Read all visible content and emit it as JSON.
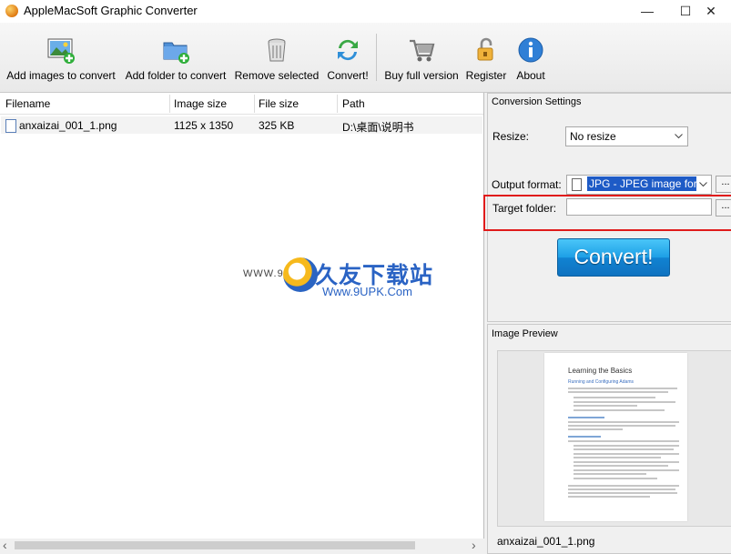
{
  "window": {
    "title": "AppleMacSoft Graphic Converter",
    "minimize": "—",
    "maximize": "☐",
    "close": "✕"
  },
  "toolbar": {
    "add_images": "Add images to convert",
    "add_folder": "Add folder to convert",
    "remove_selected": "Remove selected",
    "convert": "Convert!",
    "buy_full": "Buy full version",
    "register": "Register",
    "about": "About"
  },
  "file_list": {
    "columns": [
      "Filename",
      "Image size",
      "File size",
      "Path"
    ],
    "rows": [
      {
        "filename": "anxaizai_001_1.png",
        "image_size": "1125 x 1350",
        "file_size": "325 KB",
        "path": "D:\\桌面\\说明书"
      }
    ]
  },
  "settings": {
    "section_title": "Conversion Settings",
    "resize_label": "Resize:",
    "resize_value": "No resize",
    "output_format_label": "Output format:",
    "output_format_value": "JPG - JPEG image forma",
    "target_folder_label": "Target folder:",
    "target_folder_value": "",
    "browse": "...",
    "convert_button": "Convert!"
  },
  "preview": {
    "section_title": "Image Preview",
    "doc_title": "Learning the Basics",
    "doc_subtitle": "Running and Configuring Adams",
    "filename": "anxaizai_001_1.png"
  },
  "watermark": {
    "left": "WWW.9U",
    "text": "久友下载站",
    "url": "Www.9UPK.Com"
  },
  "scroll": {
    "left": "‹",
    "right": "›"
  },
  "colors": {
    "accent": "#1d9fe6",
    "highlight_border": "#e01b1b",
    "selection": "#1e5bc6"
  }
}
